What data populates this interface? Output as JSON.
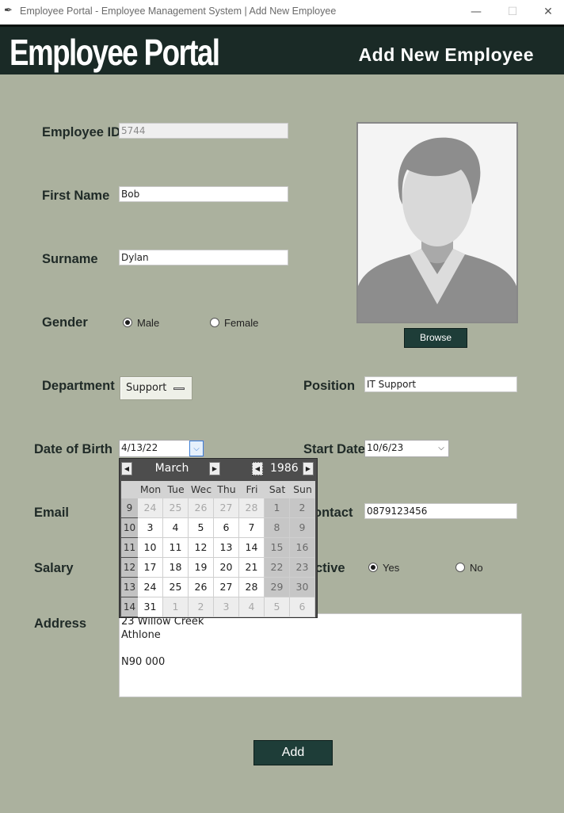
{
  "window": {
    "title": "Employee Portal - Employee Management System | Add New Employee",
    "minimize_glyph": "—",
    "maximize_glyph": "☐",
    "close_glyph": "✕",
    "app_icon": "feather-icon"
  },
  "header": {
    "brand": "Employee Portal",
    "page_heading": "Add New Employee",
    "background": "#1a2a26"
  },
  "form": {
    "employee_id": {
      "label": "Employee ID",
      "value": "5744"
    },
    "first_name": {
      "label": "First Name",
      "value": "Bob"
    },
    "surname": {
      "label": "Surname",
      "value": "Dylan"
    },
    "gender": {
      "label": "Gender",
      "options": [
        {
          "label": "Male",
          "selected": true
        },
        {
          "label": "Female",
          "selected": false
        }
      ]
    },
    "department": {
      "label": "Department",
      "value": "Support"
    },
    "position": {
      "label": "Position",
      "value": "IT Support"
    },
    "date_of_birth": {
      "label": "Date of Birth",
      "value": "4/13/22"
    },
    "start_date": {
      "label": "Start Date",
      "value": "10/6/23"
    },
    "email": {
      "label": "Email"
    },
    "contact": {
      "label": "ontact",
      "value": "0879123456"
    },
    "salary": {
      "label": "Salary"
    },
    "active": {
      "label": "ctive",
      "options": [
        {
          "label": "Yes",
          "selected": true
        },
        {
          "label": "No",
          "selected": false
        }
      ]
    },
    "address": {
      "label": "Address",
      "lines": [
        "23 Willow Creek",
        "Athlone",
        "",
        "N90 000"
      ]
    },
    "browse_label": "Browse",
    "add_label": "Add"
  },
  "calendar": {
    "month": "March",
    "year": "1986",
    "prev_glyph": "◀",
    "next_glyph": "▶",
    "weekdays": [
      "Mon",
      "Tue",
      "Wec",
      "Thu",
      "Fri",
      "Sat",
      "Sun"
    ],
    "weeks": [
      {
        "num": "9",
        "days": [
          "24",
          "25",
          "26",
          "27",
          "28",
          "1",
          "2"
        ]
      },
      {
        "num": "10",
        "days": [
          "3",
          "4",
          "5",
          "6",
          "7",
          "8",
          "9"
        ]
      },
      {
        "num": "11",
        "days": [
          "10",
          "11",
          "12",
          "13",
          "14",
          "15",
          "16"
        ]
      },
      {
        "num": "12",
        "days": [
          "17",
          "18",
          "19",
          "20",
          "21",
          "22",
          "23"
        ]
      },
      {
        "num": "13",
        "days": [
          "24",
          "25",
          "26",
          "27",
          "28",
          "29",
          "30"
        ]
      },
      {
        "num": "14",
        "days": [
          "31",
          "1",
          "2",
          "3",
          "4",
          "5",
          "6"
        ]
      }
    ],
    "other_month_cells": [
      [
        0,
        0
      ],
      [
        0,
        1
      ],
      [
        0,
        2
      ],
      [
        0,
        3
      ],
      [
        0,
        4
      ],
      [
        5,
        1
      ],
      [
        5,
        2
      ],
      [
        5,
        3
      ],
      [
        5,
        4
      ],
      [
        5,
        5
      ],
      [
        5,
        6
      ]
    ]
  }
}
